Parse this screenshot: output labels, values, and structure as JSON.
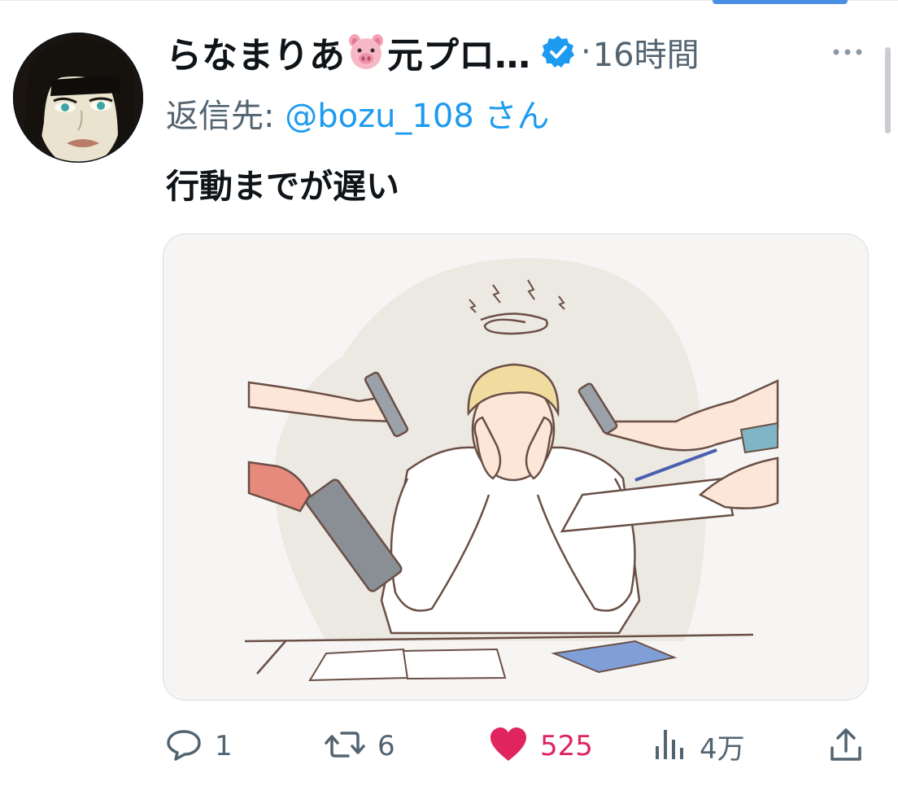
{
  "post": {
    "author_name": "らなまりあ",
    "author_name_suffix": "元プロ…",
    "author_emoji": "pig-face",
    "verified": true,
    "time_separator": "·",
    "time": "16時間",
    "reply_label": "返信先: ",
    "reply_handle": "@bozu_108",
    "reply_suffix": " さん",
    "text": "行動までが遅い"
  },
  "actions": {
    "reply": {
      "icon": "reply-icon",
      "count": "1"
    },
    "retweet": {
      "icon": "retweet-icon",
      "count": "6"
    },
    "like": {
      "icon": "heart-icon",
      "count": "525",
      "liked": true
    },
    "views": {
      "icon": "views-icon",
      "count": "4万"
    },
    "share": {
      "icon": "share-icon"
    }
  },
  "colors": {
    "text": "#0f1419",
    "muted": "#536471",
    "link": "#1d9bf0",
    "like": "#e0245e"
  }
}
